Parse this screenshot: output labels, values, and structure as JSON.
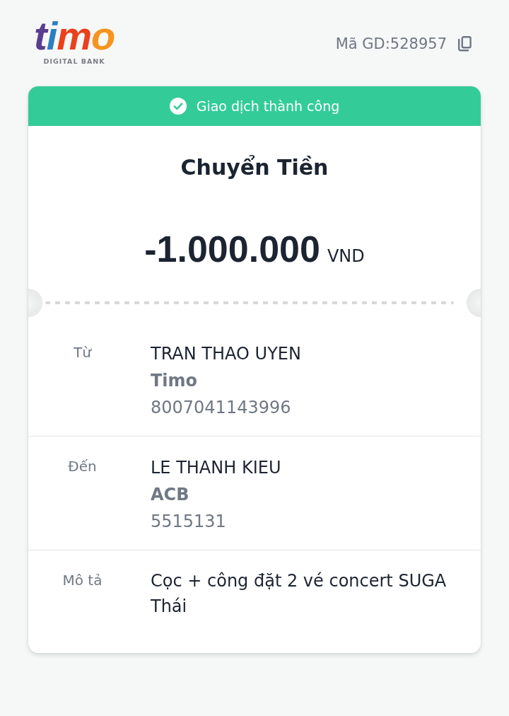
{
  "header": {
    "logo": {
      "wordmark": "timo",
      "tagline": "DIGITAL BANK"
    },
    "transaction_id": "Mã GD:528957"
  },
  "receipt": {
    "status": {
      "kind": "success",
      "text": "Giao dịch thành công"
    },
    "title": "Chuyển Tiền",
    "amount": "-1.000.000",
    "currency": "VND",
    "details": [
      {
        "kind": "party",
        "label": "Từ",
        "name": "TRAN THAO UYEN",
        "bank": "Timo",
        "account": "8007041143996"
      },
      {
        "kind": "party",
        "label": "Đến",
        "name": "LE THANH KIEU",
        "bank": "ACB",
        "account": "5515131"
      },
      {
        "kind": "note",
        "label": "Mô tả",
        "text": "Cọc + công đặt 2 vé concert SUGA Thái"
      }
    ]
  }
}
